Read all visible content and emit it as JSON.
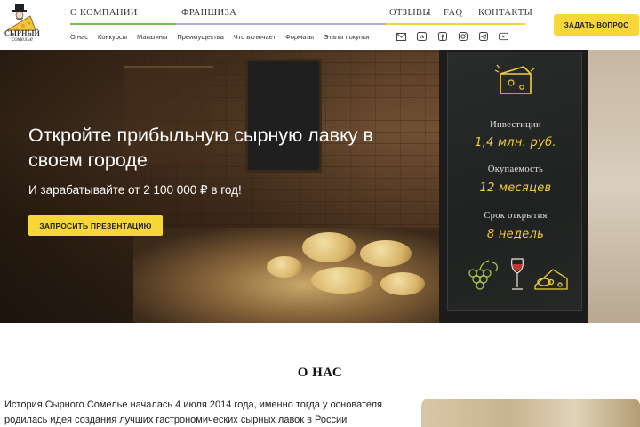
{
  "brand": {
    "logo_line1": "СЫРНЫЙ",
    "logo_line2": "сомелье"
  },
  "topnav": {
    "about": "О КОМПАНИИ",
    "franchise": "ФРАНШИЗА",
    "reviews": "ОТЗЫВЫ",
    "faq": "FAQ",
    "contacts": "КОНТАКТЫ"
  },
  "subnav": [
    "О нас",
    "Конкурсы",
    "Магазины",
    "Преимущества",
    "Что включает",
    "Форматы",
    "Этапы покупки"
  ],
  "social_icons": [
    "mail-icon",
    "vk-icon",
    "facebook-icon",
    "instagram-icon",
    "telegram-icon",
    "youtube-icon"
  ],
  "header": {
    "ask_button": "ЗАДАТЬ ВОПРОС"
  },
  "hero": {
    "title": "Откройте прибыльную сырную лавку в своем городе",
    "subtitle": "И зарабатывайте от 2 100 000 ₽ в год!",
    "button": "ЗАПРОСИТЬ ПРЕЗЕНТАЦИЮ",
    "board": {
      "label1": "Инвестиции",
      "value1": "1,4 млн. руб.",
      "label2": "Окупаемость",
      "value2": "12 месяцев",
      "label3": "Срок открытия",
      "value3": "8 недель"
    }
  },
  "about": {
    "title": "О НАС",
    "text": "История Сырного Сомелье началась 4 июля 2014 года, именно тогда у основателя родилась идея создания лучших гастрономических сырных лавок в России"
  },
  "colors": {
    "accent_yellow": "#f7d63a",
    "nav_green": "#7bb94a",
    "nav_purple": "#b6a6d6",
    "chalk_yellow": "#f1cf3a"
  }
}
